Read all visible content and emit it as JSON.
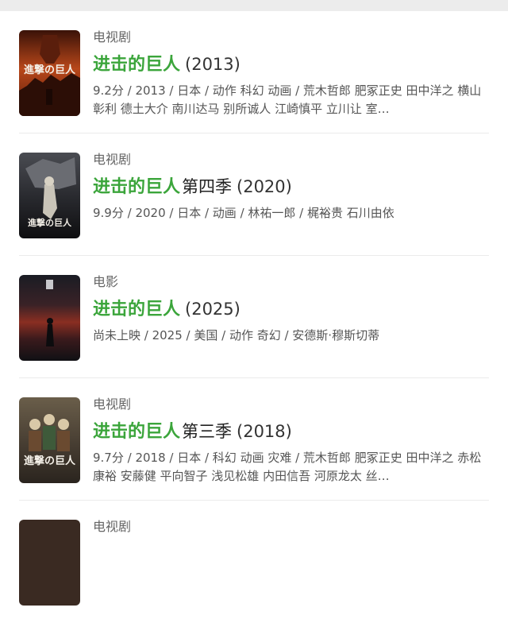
{
  "results": [
    {
      "type": "电视剧",
      "title_highlight": "进击的巨人",
      "title_rest": "",
      "year": "(2013)",
      "meta": "9.2分 / 2013 / 日本 / 动作 科幻 动画 / 荒木哲郎 肥冢正史 田中洋之 横山彰利 德土大介 南川达马 别所诚人 江崎慎平 立川让 室…",
      "poster_text": "進撃の巨人"
    },
    {
      "type": "电视剧",
      "title_highlight": "进击的巨人",
      "title_rest": "第四季",
      "year": "(2020)",
      "meta": "9.9分 / 2020 / 日本 / 动画 / 林祐一郎 / 梶裕贵 石川由依",
      "poster_text": "進撃の巨人"
    },
    {
      "type": "电影",
      "title_highlight": "进击的巨人",
      "title_rest": "",
      "year": "(2025)",
      "meta": "尚未上映 / 2025 / 美国 / 动作 奇幻 / 安德斯·穆斯切蒂",
      "poster_text": ""
    },
    {
      "type": "电视剧",
      "title_highlight": "进击的巨人",
      "title_rest": "第三季",
      "year": "(2018)",
      "meta": "9.7分 / 2018 / 日本 / 科幻 动画 灾难 / 荒木哲郎 肥冢正史 田中洋之 赤松康裕 安藤健 平向智子 浅见松雄 内田信吾 河原龙太 丝…",
      "poster_text": "進撃の巨人"
    },
    {
      "type": "电视剧",
      "title_highlight": "",
      "title_rest": "",
      "year": "",
      "meta": "",
      "poster_text": ""
    }
  ]
}
